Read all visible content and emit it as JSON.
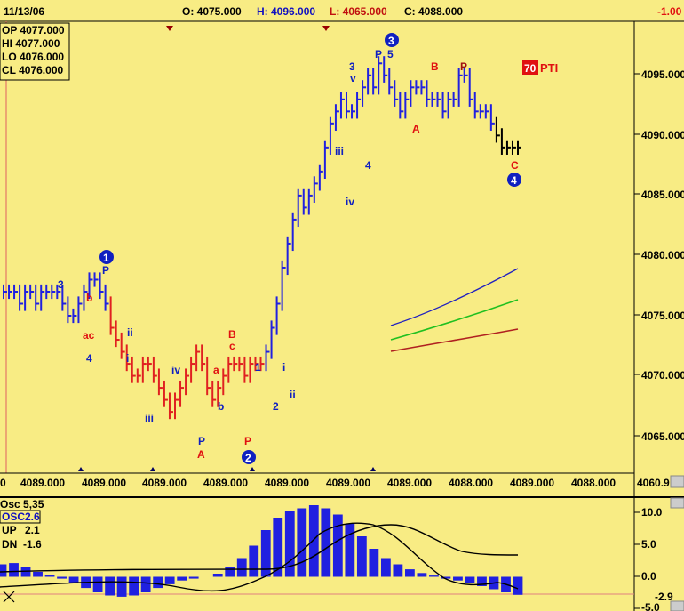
{
  "header": {
    "date": "11/13/06",
    "open": "O: 4075.000",
    "high": "H: 4096.000",
    "low": "L: 4065.000",
    "close": "C: 4088.000",
    "change": "-1.00"
  },
  "ohlc_box": {
    "op": "OP 4077.000",
    "hi": "HI  4077.000",
    "lo": "LO  4076.000",
    "cl": "CL  4076.000"
  },
  "pti": {
    "value": "70",
    "label": "PTI"
  },
  "price_axis": {
    "ticks": [
      "4095.000",
      "4090.000",
      "4085.000",
      "4080.000",
      "4075.000",
      "4070.000",
      "4065.000"
    ],
    "bottom_readout": "4060.9"
  },
  "time_axis": {
    "left_label": "0",
    "labels": [
      "4089.000",
      "4089.000",
      "4089.000",
      "4089.000",
      "4089.000",
      "4089.000",
      "4089.000",
      "4088.000",
      "4089.000"
    ],
    "right_label": "4088.000"
  },
  "oscillator": {
    "title": "Osc 5,35",
    "osc_label": "OSC2.6",
    "up_label": "UP",
    "up_value": "2.1",
    "dn_label": "DN",
    "dn_value": "-1.6",
    "ticks": [
      "10.0",
      "5.0",
      "0.0",
      "-5.0"
    ],
    "current_readout": "-2.9"
  },
  "wave_labels": {
    "w1": "1",
    "w2": "2",
    "w3": "3",
    "w4": "4",
    "p": "P",
    "five": "5",
    "b": "B",
    "a": "A",
    "c": "C",
    "three": "3",
    "v": "v",
    "four": "4",
    "iii": "iii",
    "iv": "iv",
    "i": "i",
    "ii": "ii",
    "one": "1",
    "two": "2",
    "ac": "ac",
    "lower_b": "b",
    "lower_a": "a",
    "lower_c": "c"
  },
  "colors": {
    "background": "#f8ec84",
    "blue_bars": "#2020e0",
    "red_bars": "#e02020",
    "black_bars": "#000000",
    "green_line": "#20c020",
    "dark_red_line": "#b02020",
    "blue_line": "#2020c0"
  },
  "chart_data": [
    {
      "type": "line",
      "title": "",
      "xlabel": "",
      "ylabel": "",
      "ylim": [
        4060.9,
        4098.5
      ],
      "series": [
        {
          "values": [
            4076,
            4076,
            4076,
            4075,
            4076,
            4076,
            4075,
            4076,
            4076,
            4076,
            4076,
            4075,
            4074,
            4074,
            4075,
            4076,
            4077,
            4077,
            4076,
            4075,
            4073,
            4072,
            4071,
            4070,
            4069,
            4069,
            4070,
            4070,
            4069,
            4068,
            4067,
            4066,
            4067,
            4068,
            4069,
            4070,
            4071,
            4070,
            4068,
            4067,
            4068,
            4069,
            4070,
            4070,
            4070,
            4069,
            4070,
            4070,
            4070,
            4071,
            4073,
            4075,
            4078,
            4080,
            4082,
            4084,
            4083,
            4084,
            4085,
            4086,
            4088,
            4090,
            4091,
            4092,
            4091,
            4091,
            4092,
            4093,
            4094,
            4093,
            4095,
            4094,
            4093,
            4092,
            4091,
            4092,
            4093,
            4093,
            4093,
            4092,
            4092,
            4092,
            4091,
            4092,
            4092,
            4094,
            4094,
            4092,
            4091,
            4091,
            4091,
            4090,
            4089,
            4088,
            4088,
            4088,
            4088
          ]
        }
      ]
    },
    {
      "type": "bar",
      "title": "Osc 5,35",
      "ylim": [
        -5.5,
        12.5
      ],
      "series": [
        {
          "name": "OSC2.6",
          "values": [
            2.0,
            2.2,
            1.5,
            0.8,
            0.3,
            -0.3,
            -1.0,
            -1.8,
            -2.5,
            -3.0,
            -3.2,
            -3.0,
            -2.5,
            -1.8,
            -1.2,
            -0.6,
            -0.3,
            0.0,
            0.5,
            1.5,
            3.0,
            5.0,
            7.5,
            9.5,
            10.5,
            11.0,
            11.5,
            11.0,
            10.0,
            8.5,
            6.5,
            4.5,
            3.0,
            2.0,
            1.2,
            0.6,
            0.2,
            -0.3,
            -0.6,
            -1.0,
            -1.5,
            -2.0,
            -2.5,
            -2.9
          ]
        }
      ]
    }
  ]
}
